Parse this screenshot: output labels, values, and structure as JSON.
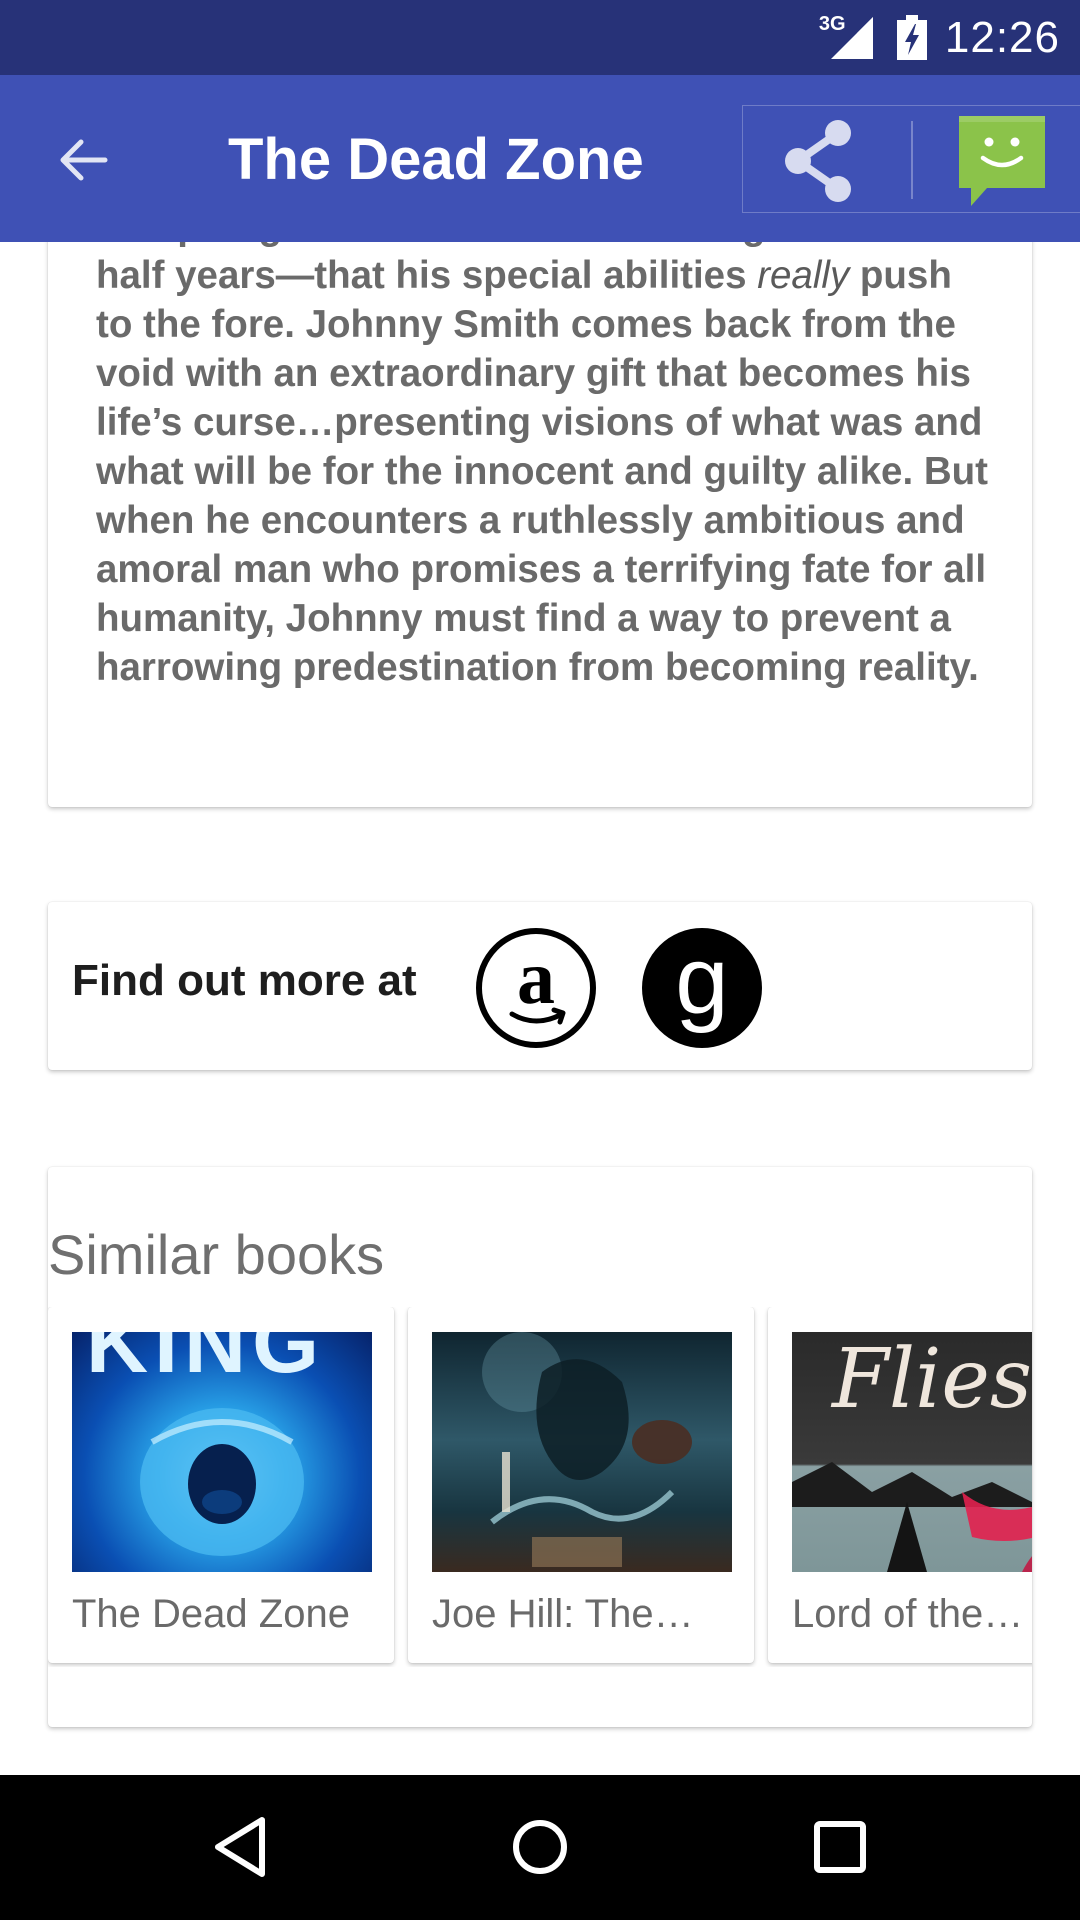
{
  "status_bar": {
    "network": "3G",
    "time": "12:26",
    "icons": [
      "signal-icon",
      "battery-icon"
    ]
  },
  "app_bar": {
    "title": "The Dead Zone",
    "icons": [
      "back-arrow-icon",
      "share-icon",
      "chat-icon"
    ]
  },
  "description": {
    "before_emphasis": "that plunged him into a coma lasting four-and-a-half years—that his special abilities ",
    "emphasis": "really",
    "after_emphasis": " push to the fore. Johnny Smith comes back from the void with an extraordinary gift that becomes his life’s curse…presenting visions of what was and what will be for the innocent and guilty alike. But when he encounters a ruthlessly ambitious and amoral man who promises a terrifying fate for all humanity, Johnny must find a way to prevent a harrowing predestination from becoming reality."
  },
  "find_out_more": {
    "label": "Find out more at",
    "amazon_glyph": "a",
    "goodreads_glyph": "g",
    "icons": [
      "amazon-icon",
      "goodreads-icon"
    ]
  },
  "similar_books": {
    "title": "Similar books",
    "books": [
      {
        "title": "The Dead Zone",
        "cover_text": "KING"
      },
      {
        "title": "Joe Hill: The…",
        "cover_text": ""
      },
      {
        "title": "Lord of the…",
        "cover_text": "Flies"
      }
    ]
  },
  "nav_bar": {
    "icons": [
      "back-triangle-icon",
      "home-circle-icon",
      "recents-square-icon"
    ]
  },
  "colors": {
    "status_bar": "#273278",
    "app_bar": "#3f51b5",
    "chat_green": "#8bc34a",
    "body_text": "#6a6a6a"
  }
}
